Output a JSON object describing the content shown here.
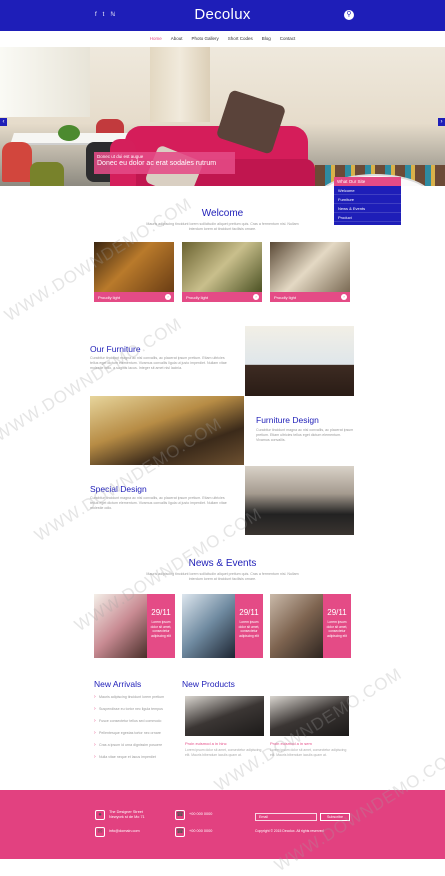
{
  "header": {
    "logo": "Decolux",
    "social": [
      "f",
      "t",
      "ℕ"
    ],
    "search_icon": "search-icon"
  },
  "nav": [
    "Home",
    "About",
    "Photo Gallery",
    "Short Codes",
    "Blog",
    "Contact"
  ],
  "hero": {
    "caption_small": "Donec ut dui est augue",
    "caption_big": "Donec eu dolor ac erat sodales rutrum",
    "dropdown_title": "What Our Site",
    "dropdown_items": [
      "Welcome",
      "Furniture",
      "News & Events",
      "Product"
    ]
  },
  "welcome": {
    "title": "Welcome",
    "desc": "Mauris adipiscing tincidunt lorem sollicitudin aliquet pretium quis. Cras a fermentum nisl. Nullam interdum lorem at tincidunt facilisis ornare.",
    "cards": [
      {
        "label": "Proudly light"
      },
      {
        "label": "Proudly light"
      },
      {
        "label": "Proudly light"
      }
    ]
  },
  "features": [
    {
      "title": "Our Furniture",
      "text": "Curabitur tincidunt magna ac nisl convallis, ac placerat ipsum pretium. Etiam ultricies tellus eget dictum elementum. Vivamus convallis ligula ut justo imperdiet. Nullam vitae molestie odio, a sagittis lacus. Integer sit amet nisl lacinia."
    },
    {
      "title": "Furniture Design",
      "text": "Curabitur tincidunt magna ac nisl convallis, ac placerat ipsum pretium. Etiam ultricies tellus eget dictum elementum. Vivamus convallis."
    },
    {
      "title": "Special Design",
      "text": "Curabitur tincidunt magna ac nisl convallis, ac placerat ipsum pretium. Etiam ultricies tellus eget dictum elementum. Vivamus convallis ligula ut justo imperdiet. Nullam vitae molestie odio."
    }
  ],
  "news": {
    "title": "News & Events",
    "desc": "Mauris adipiscing tincidunt lorem sollicitudin aliquet pretium quis. Cras a fermentum nisl. Nullam interdum lorem at tincidunt facilisis ornare.",
    "items": [
      {
        "date": "29/11",
        "text": "Lorem ipsum dolor sit amet, consectetur adipiscing elit"
      },
      {
        "date": "29/11",
        "text": "Lorem ipsum dolor sit amet, consectetur adipiscing elit"
      },
      {
        "date": "29/11",
        "text": "Lorem ipsum dolor sit amet, consectetur adipiscing elit"
      }
    ]
  },
  "new_arrivals": {
    "title": "New Arrivals",
    "items": [
      "Mauris adipiscing tincidunt lorem pretium",
      "Suspendisse eu tortor nec ligula tempus",
      "Fusce consectetur tellus sed commodo",
      "Pellentesque egestas tortor nec ornare",
      "Cras a ipsum id urna dignissim posuere",
      "Nulla vitae neque et lacus imperdiet"
    ]
  },
  "new_products": {
    "title": "New Products",
    "items": [
      {
        "link": "Proin euismod a in hinc",
        "desc": "Lorem ipsum dolor sit amet, consectetur adipiscing elit. Mauris bibendum iaculis quam at."
      },
      {
        "link": "Proin euismod a in sem",
        "desc": "Lorem ipsum dolor sit amet, consectetur adipiscing elit. Mauris bibendum iaculis quam at."
      }
    ]
  },
  "footer": {
    "address": "The Designer Street\nNewyork st de Mo 71",
    "phone1": "+00 000 0000",
    "email": "info@domain.com",
    "phone2": "+00 000 0000",
    "email_placeholder": "Email",
    "subscribe": "Subscribe",
    "copyright": "Copyright © 2015 Decolux. All rights reserved"
  },
  "watermark": "WWW.DOWNDEMO.COM"
}
